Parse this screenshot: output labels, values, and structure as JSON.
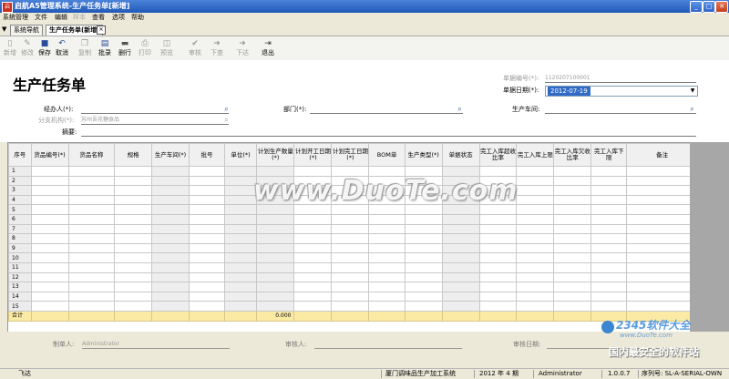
{
  "window": {
    "title": "启航A5管理系统-生产任务单[新增]"
  },
  "menu": [
    {
      "label": "系统管理",
      "enabled": true
    },
    {
      "label": "文件",
      "enabled": true
    },
    {
      "label": "编辑",
      "enabled": true
    },
    {
      "label": "样本",
      "enabled": false
    },
    {
      "label": "查看",
      "enabled": true
    },
    {
      "label": "选项",
      "enabled": true
    },
    {
      "label": "帮助",
      "enabled": true
    }
  ],
  "tabs": [
    {
      "label": "系统导航"
    },
    {
      "label": "生产任务单(新增)"
    }
  ],
  "toolbar": [
    {
      "label": "新增",
      "icon": "new-doc-icon",
      "enabled": false
    },
    {
      "label": "修改",
      "icon": "edit-icon",
      "enabled": false
    },
    {
      "label": "保存",
      "icon": "save-icon",
      "enabled": true
    },
    {
      "label": "取消",
      "icon": "undo-icon",
      "enabled": true
    },
    {
      "label": "复制",
      "icon": "copy-icon",
      "enabled": false
    },
    {
      "label": "批录",
      "icon": "batch-icon",
      "enabled": true
    },
    {
      "label": "删行",
      "icon": "delete-row-icon",
      "enabled": true
    },
    {
      "label": "打印",
      "icon": "print-icon",
      "enabled": false
    },
    {
      "label": "预览",
      "icon": "preview-icon",
      "enabled": false
    },
    {
      "label": "审核",
      "icon": "check-icon",
      "enabled": false
    },
    {
      "label": "下查",
      "icon": "arrow-right-icon",
      "enabled": false
    },
    {
      "label": "下达",
      "icon": "arrow-right-icon",
      "enabled": false
    },
    {
      "label": "退出",
      "icon": "exit-icon",
      "enabled": true
    }
  ],
  "form": {
    "title": "生产任务单",
    "doc_no_label": "单据编号(*):",
    "doc_no_value": "1120207100001",
    "date_label": "单据日期(*):",
    "date_value": "2012-07-19",
    "handler_label": "经办人(*):",
    "dept_label": "部门(*):",
    "workshop_label": "生产车间:",
    "branch_label": "分支机构(*):",
    "branch_value": "苏州吾花糖食品",
    "summary_label": "摘要:"
  },
  "grid": {
    "columns": [
      "序号",
      "货品编号(*)",
      "货品名称",
      "规格",
      "生产车间(*)",
      "批号",
      "单位(*)",
      "计划生产数量(*)",
      "计划开工日期(*)",
      "计划完工日期(*)",
      "BOM单",
      "生产类型(*)",
      "单据状态",
      "完工入库超收比率",
      "完工入库上限",
      "完工入库欠收比率",
      "完工入库下限",
      "备注"
    ],
    "rows": [
      "1",
      "2",
      "3",
      "4",
      "5",
      "6",
      "7",
      "8",
      "9",
      "10",
      "11",
      "12",
      "13",
      "14",
      "15"
    ],
    "total_label": "合计",
    "total_qty": "0.000"
  },
  "footer": {
    "maker_label": "制单人:",
    "maker_value": "Administrator",
    "auditor_label": "审核人:",
    "audit_date_label": "审核日期:"
  },
  "status": {
    "left": "飞达",
    "company": "厦门调味品生产加工系统",
    "period": "2012 年 4 期",
    "user": "Administrator",
    "version": "1.0.0.7",
    "serial": "序列号: SL-A-SERIAL-OWN"
  },
  "watermarks": {
    "center": "www.DuoTe.com",
    "brand_top": "2345软件大全",
    "brand_url": "www.DuoTe.com",
    "brand_bottom": "国内最安全的软件站"
  }
}
